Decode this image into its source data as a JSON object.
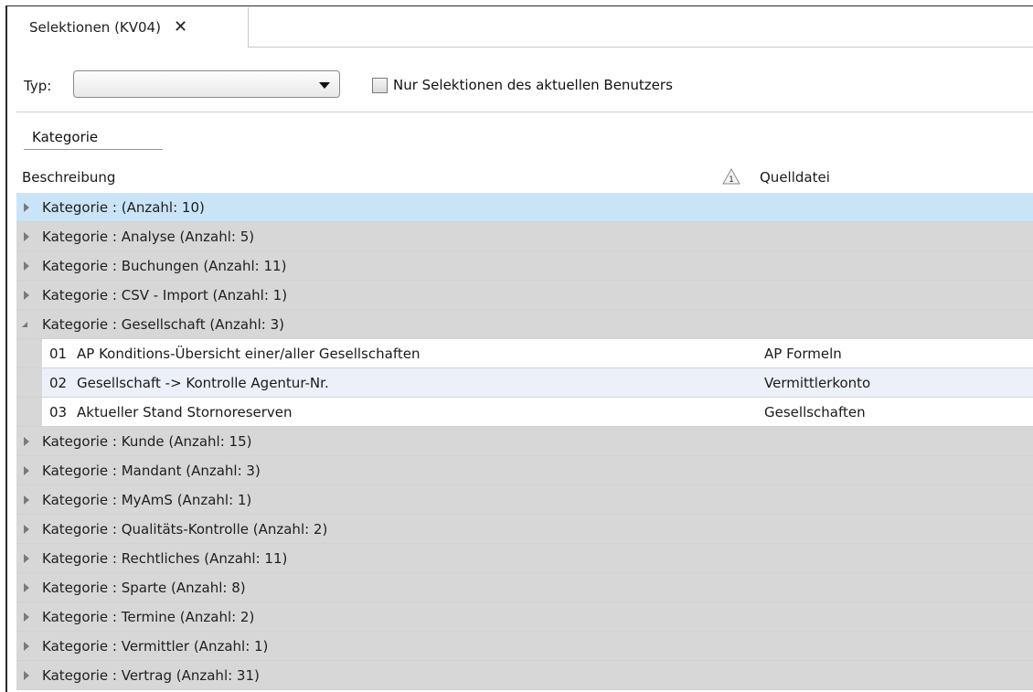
{
  "tab": {
    "title": "Selektionen (KV04)",
    "close_glyph": "✕"
  },
  "filter": {
    "typ_label": "Typ:",
    "typ_value": "",
    "checkbox_label": "Nur Selektionen des aktuellen Benutzers",
    "checkbox_checked": false
  },
  "group_panel": {
    "label": "Kategorie"
  },
  "columns": {
    "description": "Beschreibung",
    "sort_indicator": "1",
    "source": "Quelldatei"
  },
  "groups": [
    {
      "label": "Kategorie :  (Anzahl: 10)",
      "expanded": false,
      "selected": true
    },
    {
      "label": "Kategorie : Analyse (Anzahl: 5)",
      "expanded": false
    },
    {
      "label": "Kategorie : Buchungen (Anzahl: 11)",
      "expanded": false
    },
    {
      "label": "Kategorie : CSV - Import (Anzahl: 1)",
      "expanded": false
    },
    {
      "label": "Kategorie : Gesellschaft (Anzahl: 3)",
      "expanded": true,
      "rows": [
        {
          "num": "01",
          "desc": "AP Konditions-Übersicht einer/aller Gesellschaften",
          "src": "AP Formeln"
        },
        {
          "num": "02",
          "desc": "Gesellschaft -> Kontrolle Agentur-Nr.",
          "src": "Vermittlerkonto"
        },
        {
          "num": "03",
          "desc": "Aktueller Stand Stornoreserven",
          "src": "Gesellschaften"
        }
      ]
    },
    {
      "label": "Kategorie : Kunde (Anzahl: 15)",
      "expanded": false
    },
    {
      "label": "Kategorie : Mandant (Anzahl: 3)",
      "expanded": false
    },
    {
      "label": "Kategorie : MyAmS (Anzahl: 1)",
      "expanded": false
    },
    {
      "label": "Kategorie : Qualitäts-Kontrolle (Anzahl: 2)",
      "expanded": false
    },
    {
      "label": "Kategorie : Rechtliches (Anzahl: 11)",
      "expanded": false
    },
    {
      "label": "Kategorie : Sparte (Anzahl: 8)",
      "expanded": false
    },
    {
      "label": "Kategorie : Termine (Anzahl: 2)",
      "expanded": false
    },
    {
      "label": "Kategorie : Vermittler (Anzahl: 1)",
      "expanded": false
    },
    {
      "label": "Kategorie : Vertrag (Anzahl: 31)",
      "expanded": false
    }
  ],
  "icons": {
    "sort": "sort-warning-triangle-icon",
    "expander": "expand-arrow-icon",
    "close": "close-icon"
  }
}
